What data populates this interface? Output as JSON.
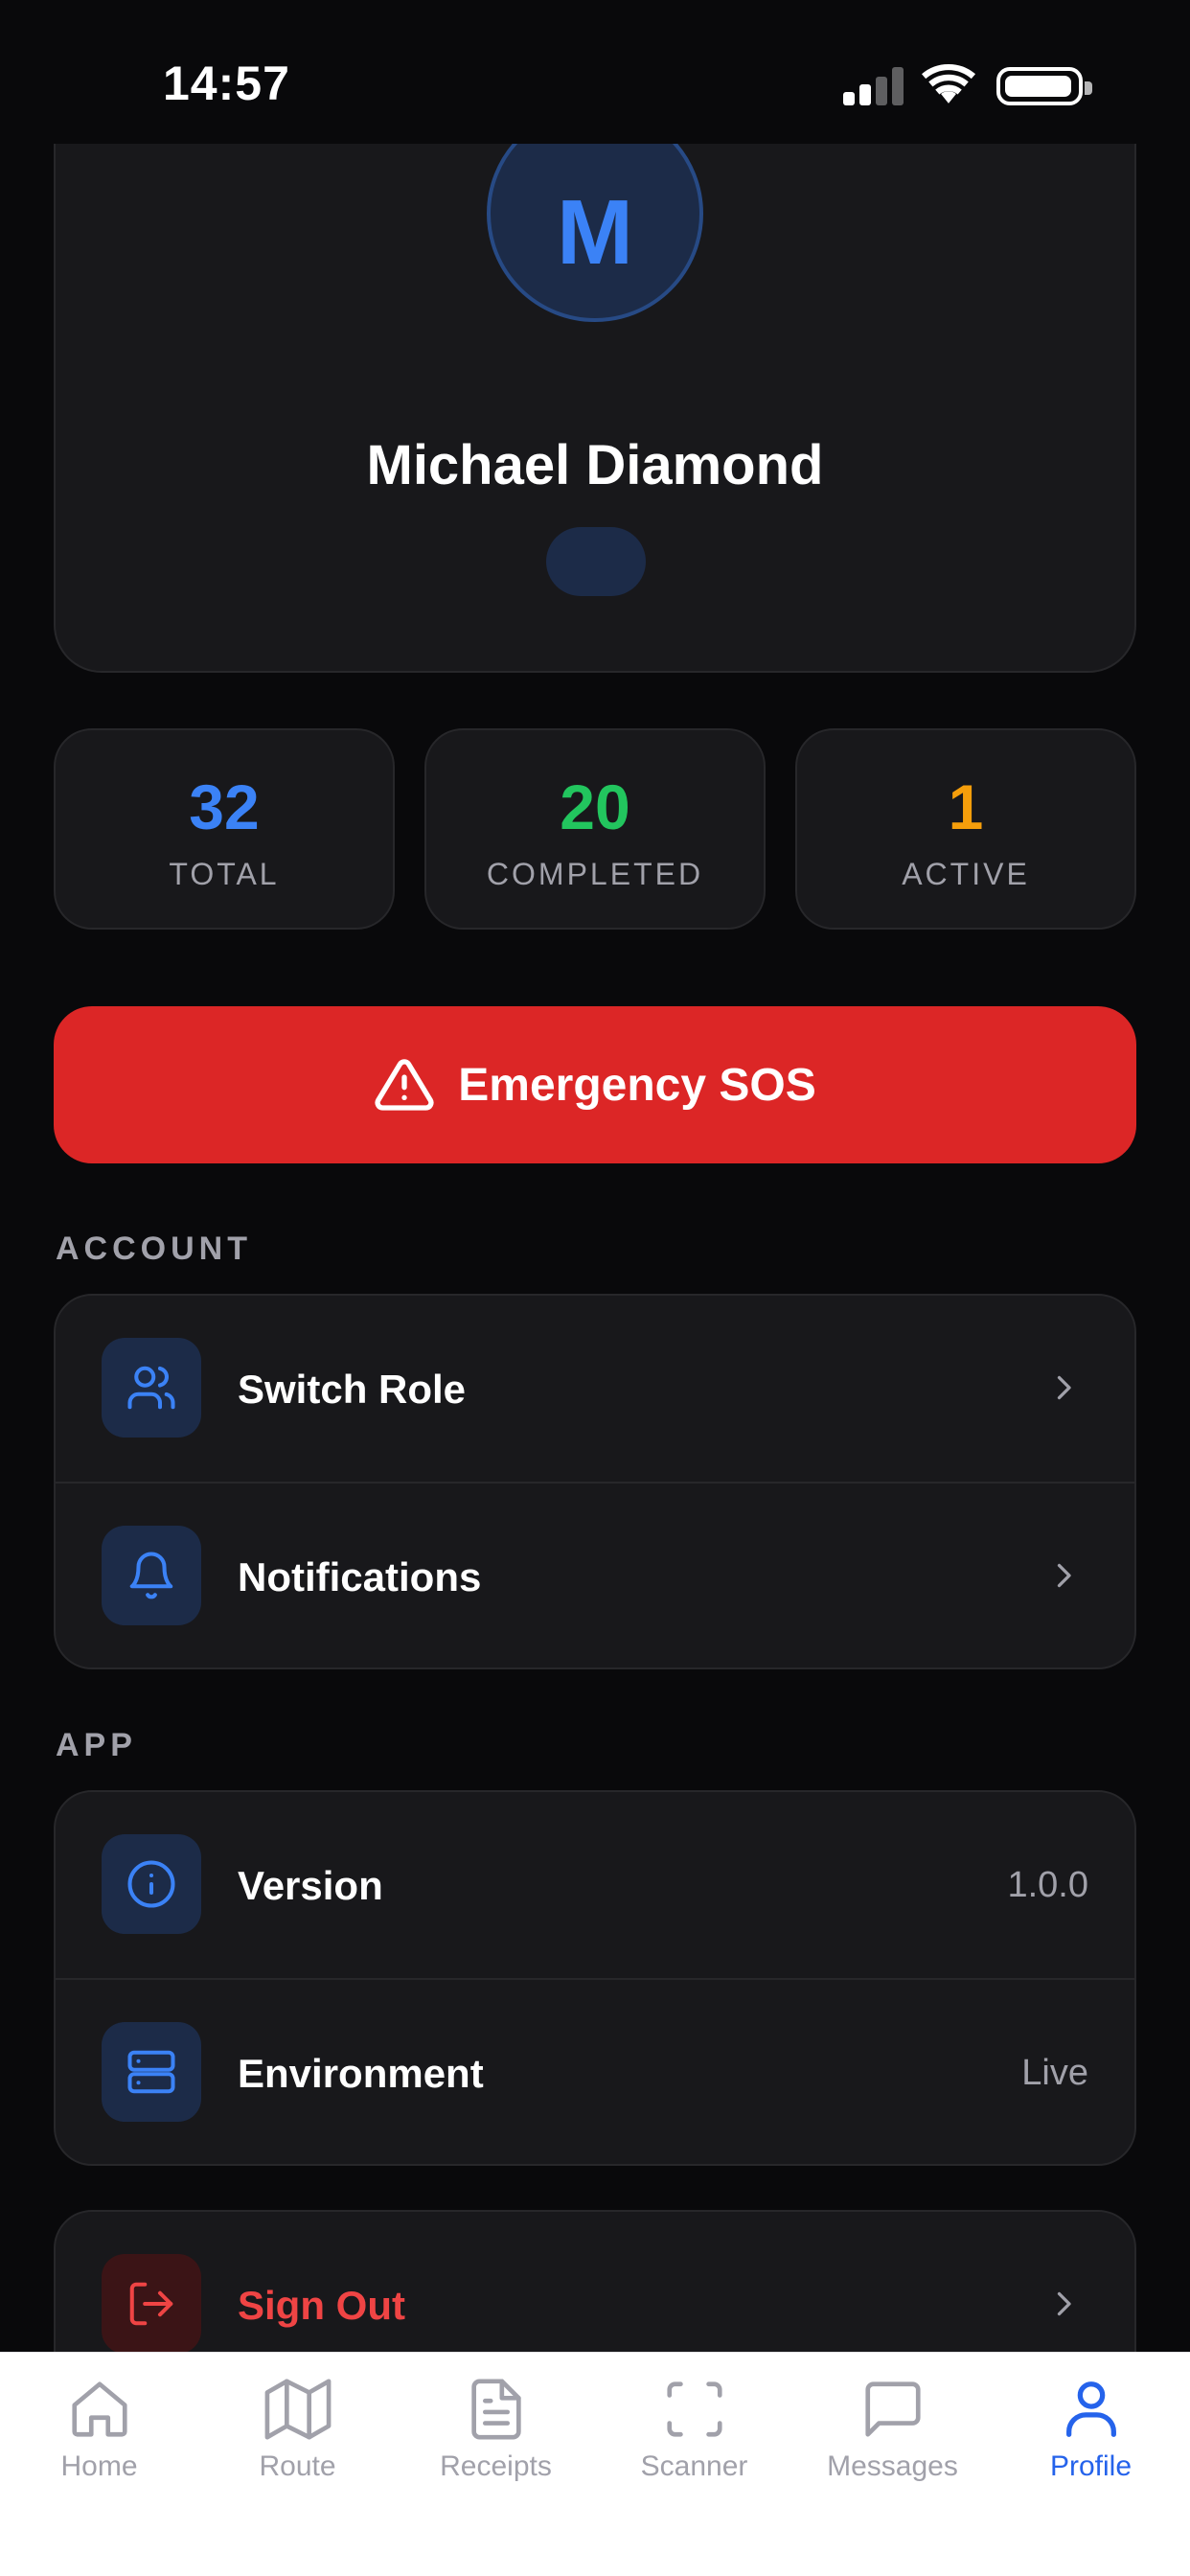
{
  "status_bar": {
    "time": "14:57"
  },
  "profile": {
    "initial": "M",
    "name": "Michael Diamond"
  },
  "stats": [
    {
      "value": "32",
      "label": "TOTAL",
      "color": "#3b82f6"
    },
    {
      "value": "20",
      "label": "COMPLETED",
      "color": "#22c55e"
    },
    {
      "value": "1",
      "label": "ACTIVE",
      "color": "#f59e0b"
    }
  ],
  "sos": {
    "label": "Emergency SOS",
    "icon": "warning-triangle-icon"
  },
  "account": {
    "title": "ACCOUNT",
    "items": [
      {
        "label": "Switch Role",
        "icon": "users-icon"
      },
      {
        "label": "Notifications",
        "icon": "bell-icon"
      }
    ]
  },
  "app": {
    "title": "APP",
    "items": [
      {
        "label": "Version",
        "value": "1.0.0",
        "icon": "info-icon"
      },
      {
        "label": "Environment",
        "value": "Live",
        "icon": "server-icon"
      }
    ]
  },
  "sign_out": {
    "label": "Sign Out",
    "icon": "log-out-icon",
    "color": "#ef4444"
  },
  "tabs": [
    {
      "label": "Home",
      "icon": "home-icon"
    },
    {
      "label": "Route",
      "icon": "map-icon"
    },
    {
      "label": "Receipts",
      "icon": "receipt-icon"
    },
    {
      "label": "Scanner",
      "icon": "scan-icon"
    },
    {
      "label": "Messages",
      "icon": "message-icon"
    },
    {
      "label": "Profile",
      "icon": "user-icon",
      "active": true
    }
  ],
  "colors": {
    "accent": "#2563eb",
    "sos": "#dc2626",
    "background": "#09090b",
    "card": "#18181b"
  }
}
